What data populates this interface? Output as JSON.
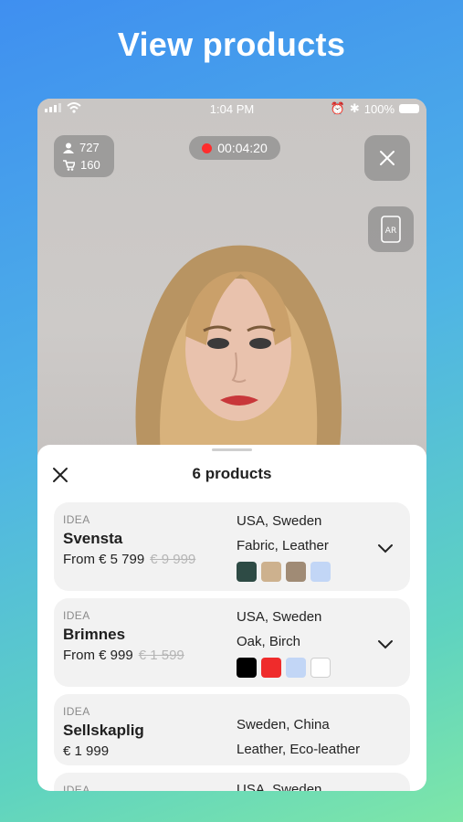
{
  "headline": "View products",
  "status_bar": {
    "time": "1:04 PM",
    "battery": "100%"
  },
  "live": {
    "viewers": "727",
    "cart_count": "160",
    "timer": "00:04:20",
    "ar_label": "AR"
  },
  "sheet": {
    "title": "6 products",
    "products": [
      {
        "brand": "IDEA",
        "name": "Svensta",
        "price": "From € 5 799",
        "old_price": "€ 9 999",
        "origin": "USA, Sweden",
        "material": "Fabric, Leather",
        "swatches": [
          "#2e4b45",
          "#cdb18e",
          "#a08b75",
          "#c2d6f6"
        ]
      },
      {
        "brand": "IDEA",
        "name": "Brimnes",
        "price": "From € 999",
        "old_price": "€ 1 599",
        "origin": "USA, Sweden",
        "material": "Oak, Birch",
        "swatches": [
          "#000000",
          "#ef2b2b",
          "#c2d6f6",
          "#ffffff"
        ]
      },
      {
        "brand": "IDEA",
        "name": "Sellskaplig",
        "price": "€ 1 999",
        "origin": "Sweden, China",
        "material": "Leather, Eco-leather"
      },
      {
        "brand": "IDEA",
        "origin": "USA, Sweden"
      }
    ]
  }
}
